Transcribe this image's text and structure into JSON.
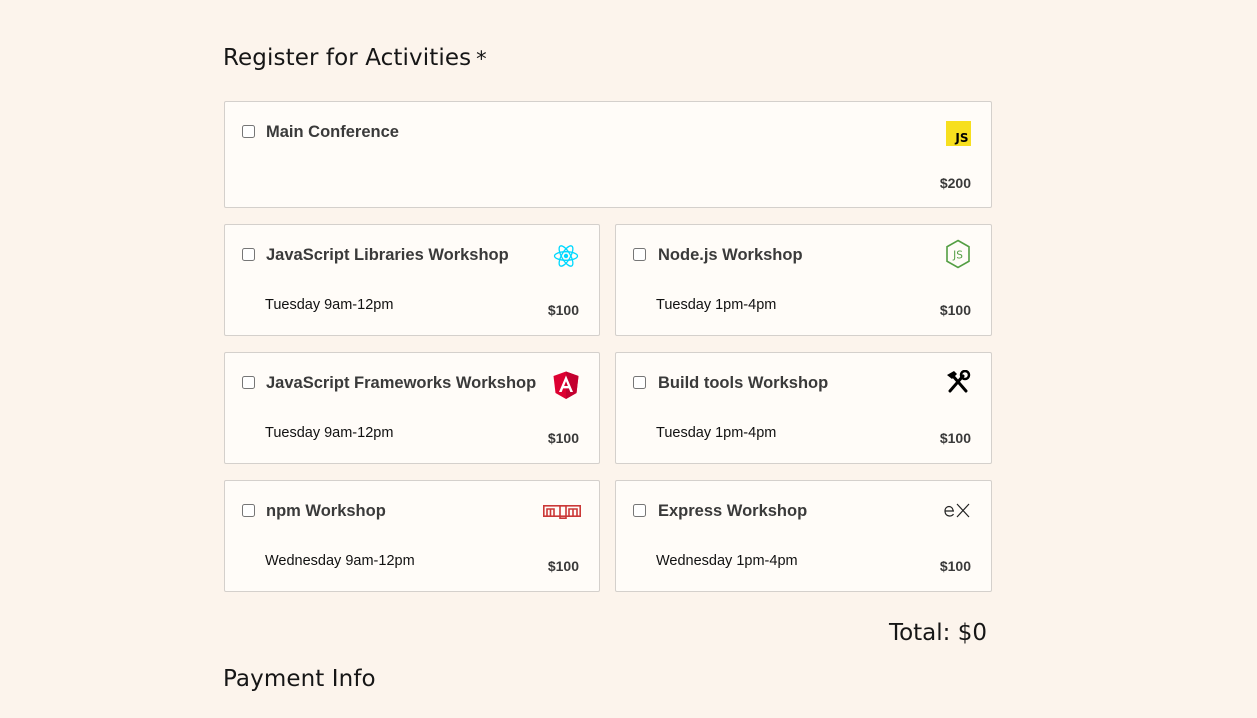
{
  "activities": {
    "title": "Register for Activities",
    "required_mark": "*",
    "main": {
      "name": "Main Conference",
      "price": "$200",
      "icon": "javascript-icon",
      "icon_text": "JS",
      "icon_color": "#f7df1e"
    },
    "workshops": [
      {
        "name": "JavaScript Libraries Workshop",
        "time": "Tuesday 9am-12pm",
        "price": "$100",
        "icon": "react-icon",
        "icon_color": "#00d8ff"
      },
      {
        "name": "Node.js Workshop",
        "time": "Tuesday 1pm-4pm",
        "price": "$100",
        "icon": "nodejs-icon",
        "icon_color": "#539e43"
      },
      {
        "name": "JavaScript Frameworks Workshop",
        "time": "Tuesday 9am-12pm",
        "price": "$100",
        "icon": "angular-icon",
        "icon_color": "#dd0031"
      },
      {
        "name": "Build tools Workshop",
        "time": "Tuesday 1pm-4pm",
        "price": "$100",
        "icon": "tools-icon",
        "icon_color": "#000000"
      },
      {
        "name": "npm Workshop",
        "time": "Wednesday 9am-12pm",
        "price": "$100",
        "icon": "npm-icon",
        "icon_color": "#cb3837"
      },
      {
        "name": "Express Workshop",
        "time": "Wednesday 1pm-4pm",
        "price": "$100",
        "icon": "express-icon",
        "icon_color": "#000000"
      }
    ],
    "total_label": "Total: $0"
  },
  "payment": {
    "title": "Payment Info"
  }
}
